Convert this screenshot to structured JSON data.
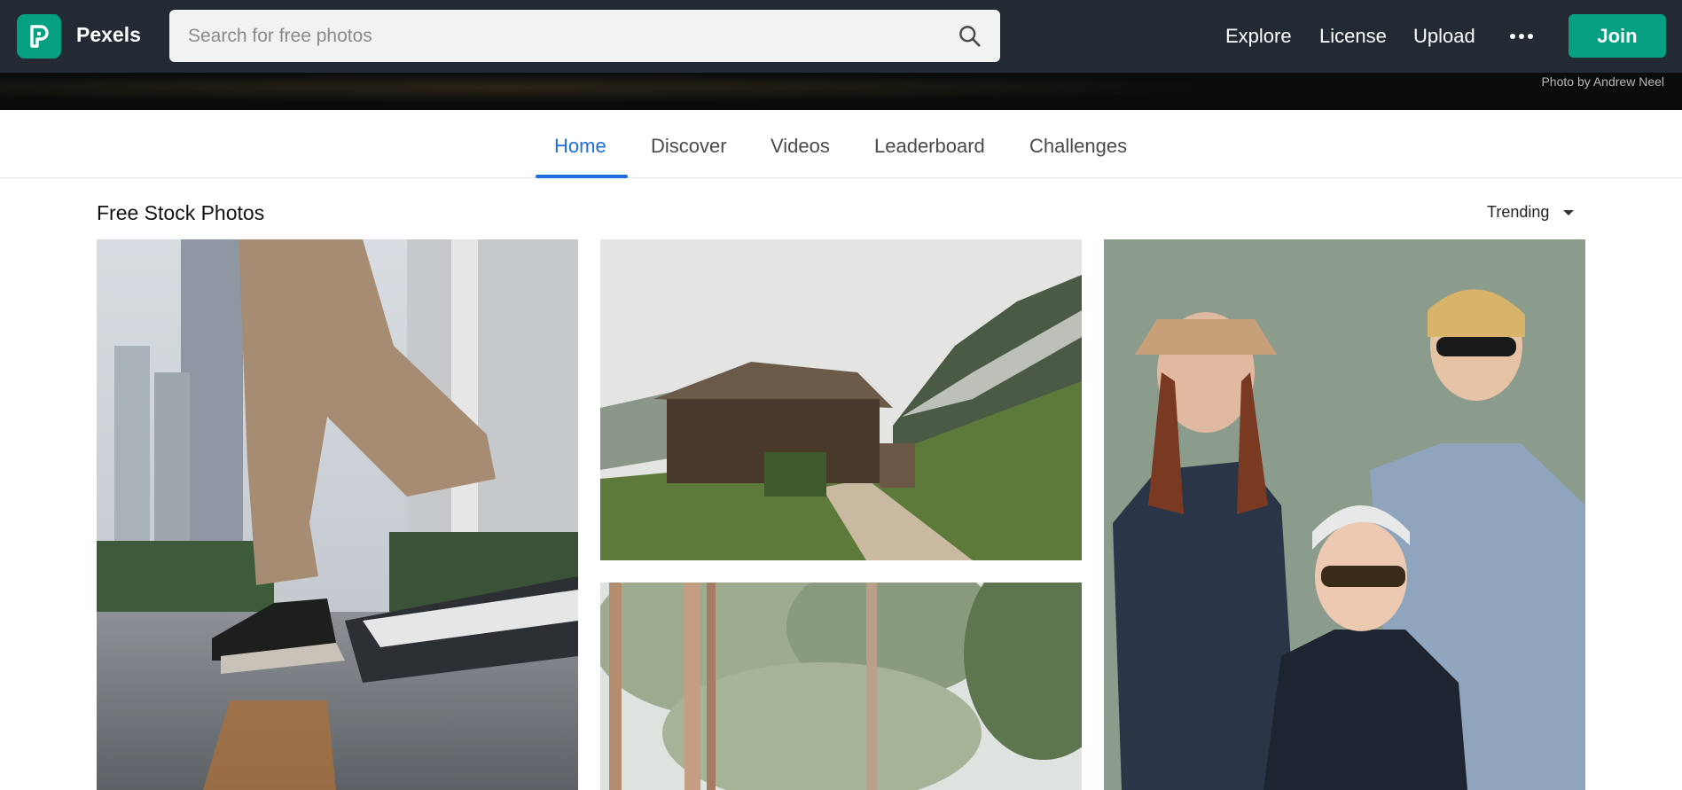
{
  "header": {
    "brand": "Pexels",
    "search_placeholder": "Search for free photos",
    "nav": [
      "Explore",
      "License",
      "Upload"
    ],
    "join_label": "Join"
  },
  "hero": {
    "credit": "Photo by Andrew Neel"
  },
  "tabs": [
    {
      "label": "Home",
      "active": true
    },
    {
      "label": "Discover",
      "active": false
    },
    {
      "label": "Videos",
      "active": false
    },
    {
      "label": "Leaderboard",
      "active": false
    },
    {
      "label": "Challenges",
      "active": false
    }
  ],
  "section": {
    "title": "Free Stock Photos",
    "sort_label": "Trending"
  },
  "colors": {
    "header_bg": "#232a34",
    "brand_green": "#05a081",
    "active_tab": "#1f6ee0"
  },
  "icons": [
    "pexels-logo-icon",
    "search-icon",
    "more-dots-icon",
    "caret-down-icon"
  ]
}
